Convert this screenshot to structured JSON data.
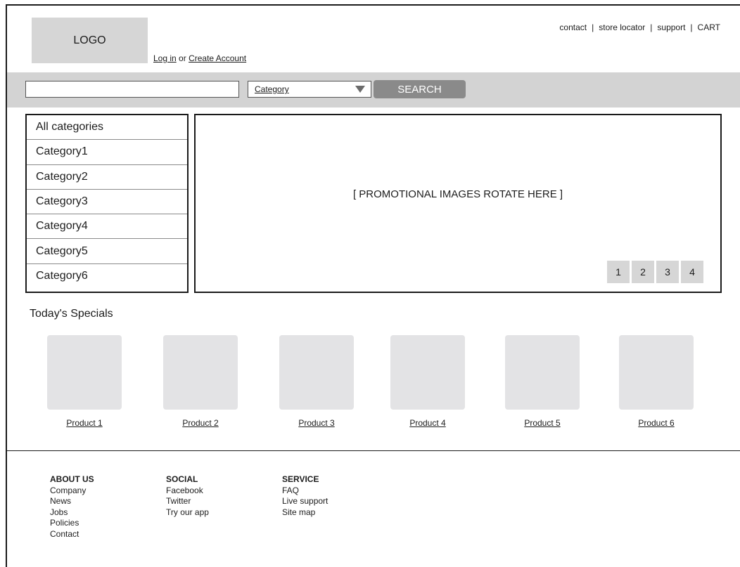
{
  "header": {
    "logo_text": "LOGO",
    "login_label": "Log in",
    "or_text": "or",
    "create_account_label": "Create Account",
    "utility_links": [
      "contact",
      "store locator",
      "support",
      "CART"
    ]
  },
  "search": {
    "input_value": "",
    "category_label": "Category",
    "button_label": "SEARCH"
  },
  "categories": [
    "All categories",
    "Category1",
    "Category2",
    "Category3",
    "Category4",
    "Category5",
    "Category6"
  ],
  "promo": {
    "text": "[ PROMOTIONAL IMAGES ROTATE HERE ]",
    "pages": [
      "1",
      "2",
      "3",
      "4"
    ]
  },
  "specials": {
    "heading": "Today's Specials",
    "products": [
      "Product 1",
      "Product 2",
      "Product 3",
      "Product 4",
      "Product 5",
      "Product 6"
    ]
  },
  "footer": {
    "about": {
      "heading": "ABOUT US",
      "links": [
        "Company",
        "News",
        "Jobs",
        "Policies",
        "Contact"
      ]
    },
    "social": {
      "heading": "SOCIAL",
      "links": [
        "Facebook",
        "Twitter",
        "Try our app"
      ]
    },
    "service": {
      "heading": "SERVICE",
      "links": [
        "FAQ",
        "Live support",
        "Site map"
      ]
    }
  },
  "colors": {
    "placeholder_gray": "#d6d6d6",
    "search_bar_bg": "#d3d3d3",
    "search_button": "#8a8a8a",
    "product_thumb": "#e3e3e5",
    "border": "#1a1a1a"
  }
}
